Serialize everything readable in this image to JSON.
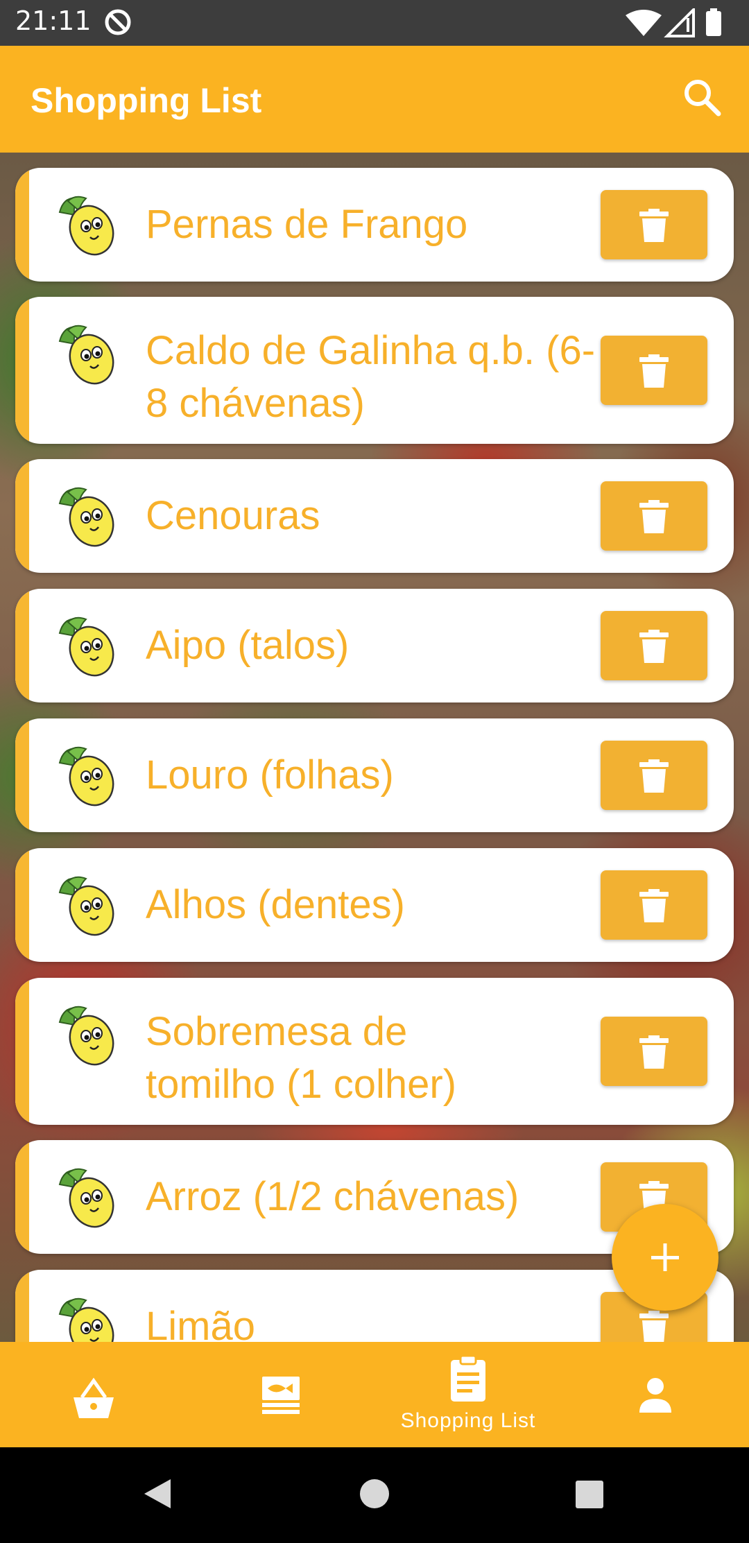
{
  "status_bar": {
    "time": "21:11",
    "icons": [
      "at-sign-icon",
      "wifi-icon",
      "signal-icon",
      "battery-icon"
    ]
  },
  "app_bar": {
    "title": "Shopping List",
    "search_icon": "search-icon"
  },
  "colors": {
    "accent": "#fbb321",
    "item_text": "#f7b02a",
    "delete_button": "#f2b132"
  },
  "items": [
    {
      "label": "Pernas de Frango"
    },
    {
      "label": "Caldo de Galinha q.b. (6-8 chávenas)"
    },
    {
      "label": "Cenouras"
    },
    {
      "label": "Aipo (talos)"
    },
    {
      "label": "Louro (folhas)"
    },
    {
      "label": "Alhos (dentes)"
    },
    {
      "label": "Sobremesa de tomilho (1 colher)"
    },
    {
      "label": "Arroz (1/2 chávenas)"
    },
    {
      "label": "Limão"
    }
  ],
  "fab": {
    "icon": "plus-icon"
  },
  "bottom_nav": {
    "items": [
      {
        "icon": "basket-icon",
        "label": ""
      },
      {
        "icon": "recipe-icon",
        "label": ""
      },
      {
        "icon": "clipboard-icon",
        "label": "Shopping List",
        "selected": true
      },
      {
        "icon": "person-icon",
        "label": ""
      }
    ]
  },
  "system_nav": [
    "back-icon",
    "home-icon",
    "recents-icon"
  ]
}
